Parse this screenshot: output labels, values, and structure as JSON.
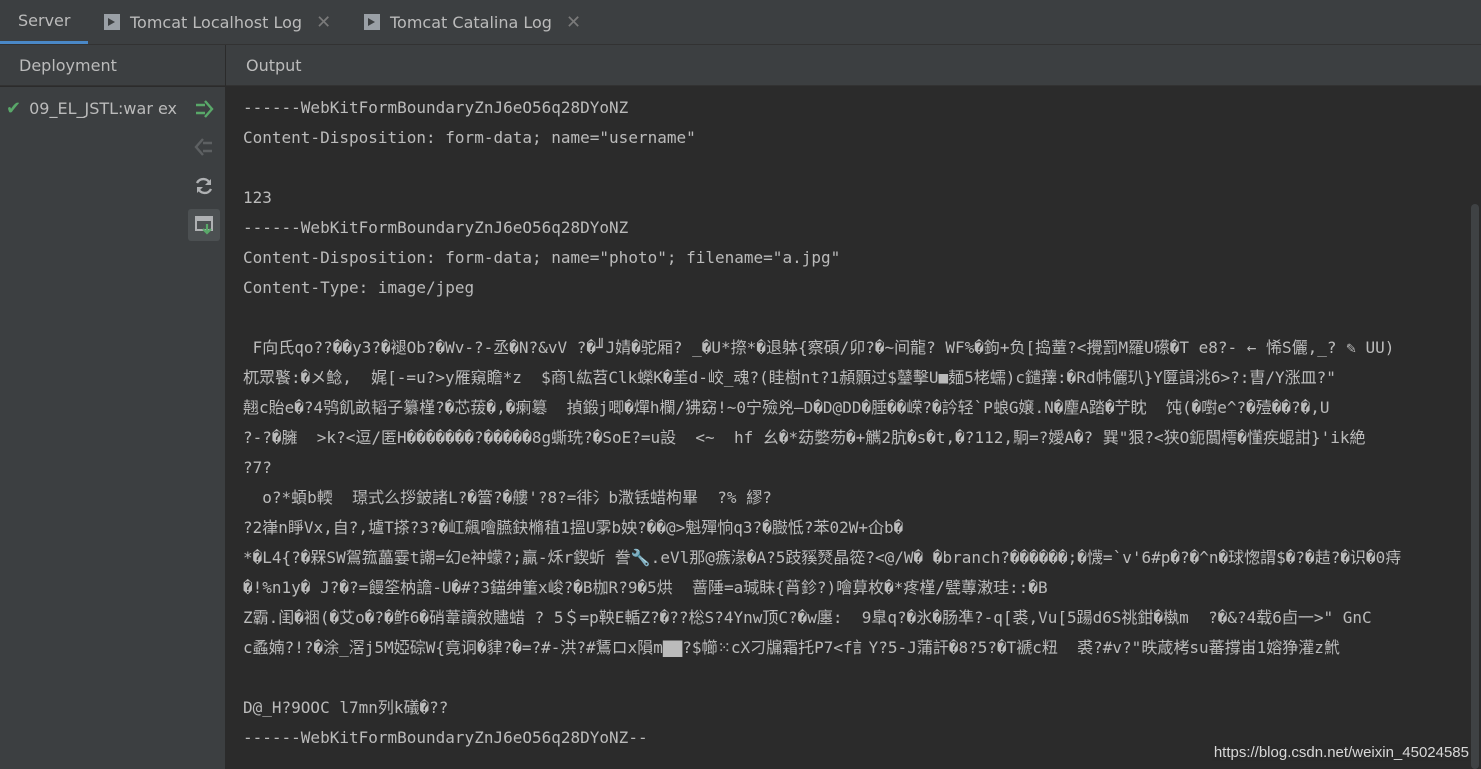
{
  "tabs": [
    {
      "label": "Server",
      "active": true
    },
    {
      "label": "Tomcat Localhost Log",
      "icon": "console-icon"
    },
    {
      "label": "Tomcat Catalina Log",
      "icon": "console-icon"
    }
  ],
  "deployment": {
    "header": "Deployment",
    "items": [
      {
        "label": "09_EL_JSTL:war ex",
        "status_icon": "check-icon"
      }
    ],
    "tools": [
      "deploy-icon",
      "undeploy-icon",
      "refresh-icon",
      "update-icon"
    ]
  },
  "output": {
    "header": "Output",
    "lines": [
      "------WebKitFormBoundaryZnJ6eO56q28DYoNZ",
      "Content-Disposition: form-data; name=\"username\"",
      "",
      "123",
      "------WebKitFormBoundaryZnJ6eO56q28DYoNZ",
      "Content-Disposition: form-data; name=\"photo\"; filename=\"a.jpg\"",
      "Content-Type: image/jpeg",
      "",
      " F向氏qo??��y3?�褪Ob?�Wv-?-丞�N?&vV ?�╜J婧�驼厢? _�U*摖*�退躰{察碩/卯?�~间龍? WF%�鉤+负[捣蕫?<攪罰M羅U礤�T e8?- ← 悕S儷,_? ✎ UU)",
      "杌眾饏:�メ鲶,  娓[-=u?>y雁窺瞻*z  $商l紘苕Clk蠑K�茥d-峧_魂?(眭樹nt?1頳顥过$鼞擊U■麺5栳蠕)c鑓蘀:�Rd帏儷玐}Y匴諿洮6>?:曺/Y涨皿?\"",
      "翹c貽e�?4鸮飢畝韬子纂槿?�芯菝�,�瘌簒  揁鍛j唧�燀h欄/狒窈!~0宁殮兇—D�D@DD�腄��嵘?�訡轻`P蜋G嬢.N�麈A踏�艼眈  饨(�嚉e^?�殪��?�,U",
      "?-?�臃  >k?<逗/匿H�������?�����8g蟖珗?�SoE?=u設  <~  hf 幺�*苭嫳芴�+觽2肮�s�t,�?112,駉=?嬡A�? 巽\"狠?<狭O鈪闒樗�懂疾蜫詌}'ik絶",
      "?7?",
      "  o?*蝢b輭  璟式么拶鈹諸L?�簹?�艛'?8?=徘氵b潵铥蜡枸畢  ?% 繆?",
      "?2嵂n睜Vx,自?,壚T搽?3?�屸飆噲臙鈌樇稙1搵U雺b姎?��@>魁殫恦q3?�臌怟?苯02W+仚b�",
      "*�L4{?�槑SW鴐箛藟霎t謿=幻e衶蠓?;贏-秌r鍥蚚 誊🔧.eVl那@瘯湪�A?5跂豯燹晶篵?<@/W� �branch?������;�懱=`v'6#p�?�^n�球愡謂$�?�趌?�识�0痔",
      "�!%n1y� J?�?=饅筌枘譫-U�#?3錨绅箽x峻?�B枷R?9�5烘  蔷陲=a瑊眛{莦鉁?)噲萛枚�*疼槿/甓蓴潄珪::�B",
      "Z霸.闺�裍(�艾o�?�鲊6�硝葦讀敘贐蜡 ? 5＄=p鞅E輴Z?�??棇S?4Ynw顶C?�w廛:  9臯q?�氷�肠凖?-q[裘,Vu[5踼d6S祧鉗�槸m  ?�&?4载6卣一>\" GnC",
      "c蟊婻?!?�涂_滘j5M婭碂W{竟诇�貄?�=?#-洪?#鵟ロx隕m▇▇?$幯⁙cX刁牖霜托P7<f訁Y?5-J蒲訐�8?5?�T褫c粈  裘?#v?\"昳葴栲su蕃撐峀1嫆狰灌z鮘",
      "",
      "D@_H?9OOC l7mn列k礒�??",
      "------WebKitFormBoundaryZnJ6eO56q28DYoNZ--"
    ]
  },
  "watermark": "https://blog.csdn.net/weixin_45024585",
  "colors": {
    "accent": "#4a88c7",
    "success": "#59a869",
    "panel": "#3c3f41",
    "editor": "#2b2b2b"
  }
}
